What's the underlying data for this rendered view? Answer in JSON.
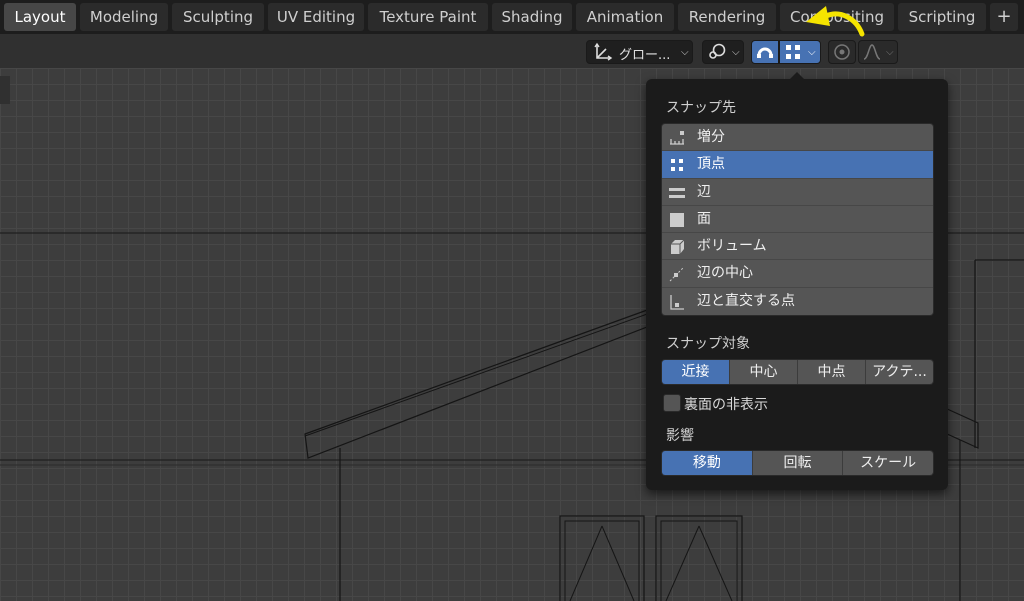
{
  "tabs": [
    {
      "label": "Layout",
      "active": true
    },
    {
      "label": "Modeling"
    },
    {
      "label": "Sculpting"
    },
    {
      "label": "UV Editing"
    },
    {
      "label": "Texture Paint"
    },
    {
      "label": "Shading"
    },
    {
      "label": "Animation"
    },
    {
      "label": "Rendering"
    },
    {
      "label": "Compositing"
    },
    {
      "label": "Scripting"
    },
    {
      "label": "+"
    }
  ],
  "toolbar": {
    "transform_orientation": "グロー...",
    "snap_on": true
  },
  "popover": {
    "snap_to_title": "スナップ先",
    "snap_to_items": [
      {
        "label": "増分",
        "icon": "increment-icon"
      },
      {
        "label": "頂点",
        "icon": "vertex-icon",
        "selected": true
      },
      {
        "label": "辺",
        "icon": "edge-icon"
      },
      {
        "label": "面",
        "icon": "face-icon"
      },
      {
        "label": "ボリューム",
        "icon": "volume-icon"
      },
      {
        "label": "辺の中心",
        "icon": "edge-center-icon"
      },
      {
        "label": "辺と直交する点",
        "icon": "edge-perpendicular-icon"
      }
    ],
    "snap_with_title": "スナップ対象",
    "snap_with": [
      "近接",
      "中心",
      "中点",
      "アクテ..."
    ],
    "snap_with_active": 0,
    "backface_label": "裏面の非表示",
    "affect_title": "影響",
    "affect": [
      "移動",
      "回転",
      "スケール"
    ],
    "affect_active": 0
  },
  "colors": {
    "accent": "#4772b3",
    "annotation": "#f5e400"
  }
}
